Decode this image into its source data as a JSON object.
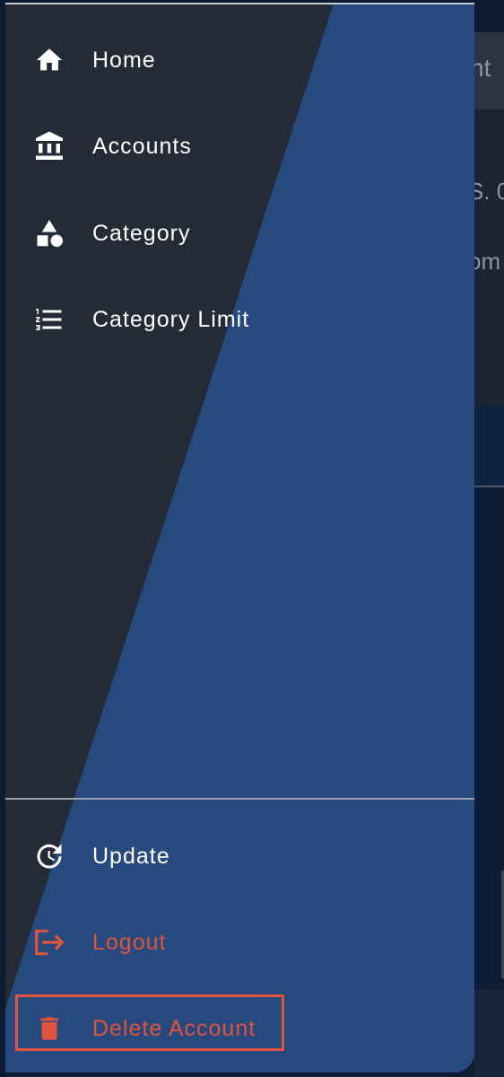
{
  "background": {
    "appbar_text_fragment": "nt",
    "card_text_fragment_1": "S. 0",
    "card_text_fragment_2": "om"
  },
  "drawer": {
    "menu": [
      {
        "label": "Home",
        "icon": "home-icon"
      },
      {
        "label": "Accounts",
        "icon": "bank-icon"
      },
      {
        "label": "Category",
        "icon": "shapes-icon"
      },
      {
        "label": "Category Limit",
        "icon": "numbered-list-icon"
      }
    ],
    "footer": [
      {
        "label": "Update",
        "icon": "update-icon"
      },
      {
        "label": "Logout",
        "icon": "logout-icon"
      },
      {
        "label": "Delete Account",
        "icon": "trash-icon"
      }
    ]
  },
  "colors": {
    "drawer_dark": "#252b36",
    "drawer_blue": "#264a7e",
    "danger": "#e0533d",
    "text": "#ffffff"
  }
}
